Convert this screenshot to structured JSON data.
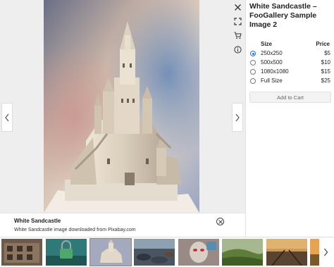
{
  "image": {
    "alt": "White Sandcastle",
    "caption_title": "White Sandcastle",
    "caption_desc": "White Sandcastle image downloaded from Pixabay.com"
  },
  "navigation": {
    "prev_icon": "chevron-left-icon",
    "next_icon": "chevron-right-icon"
  },
  "tools": {
    "close_icon": "close-icon",
    "fullscreen_icon": "fullscreen-icon",
    "cart_icon": "cart-icon",
    "info_icon": "info-icon"
  },
  "panel": {
    "title": "White Sandcastle – FooGallery Sample Image 2",
    "size_header": "Size",
    "price_header": "Price",
    "options": [
      {
        "size": "250x250",
        "price": "$5",
        "selected": true
      },
      {
        "size": "500x500",
        "price": "$10",
        "selected": false
      },
      {
        "size": "1080x1080",
        "price": "$15",
        "selected": false
      },
      {
        "size": "Full Size",
        "price": "$25",
        "selected": false
      }
    ],
    "add_to_cart": "Add to Cart"
  },
  "thumbnails": [
    {
      "name": "ruined-building"
    },
    {
      "name": "green-padlock"
    },
    {
      "name": "white-sandcastle",
      "active": true
    },
    {
      "name": "rocky-beach"
    },
    {
      "name": "mask-graffiti"
    },
    {
      "name": "green-landscape"
    },
    {
      "name": "railway-tracks"
    },
    {
      "name": "sunset-field"
    }
  ],
  "colors": {
    "accent": "#1a73e8",
    "panel_bg": "#ffffff",
    "stage_bg": "#eeeeee"
  }
}
